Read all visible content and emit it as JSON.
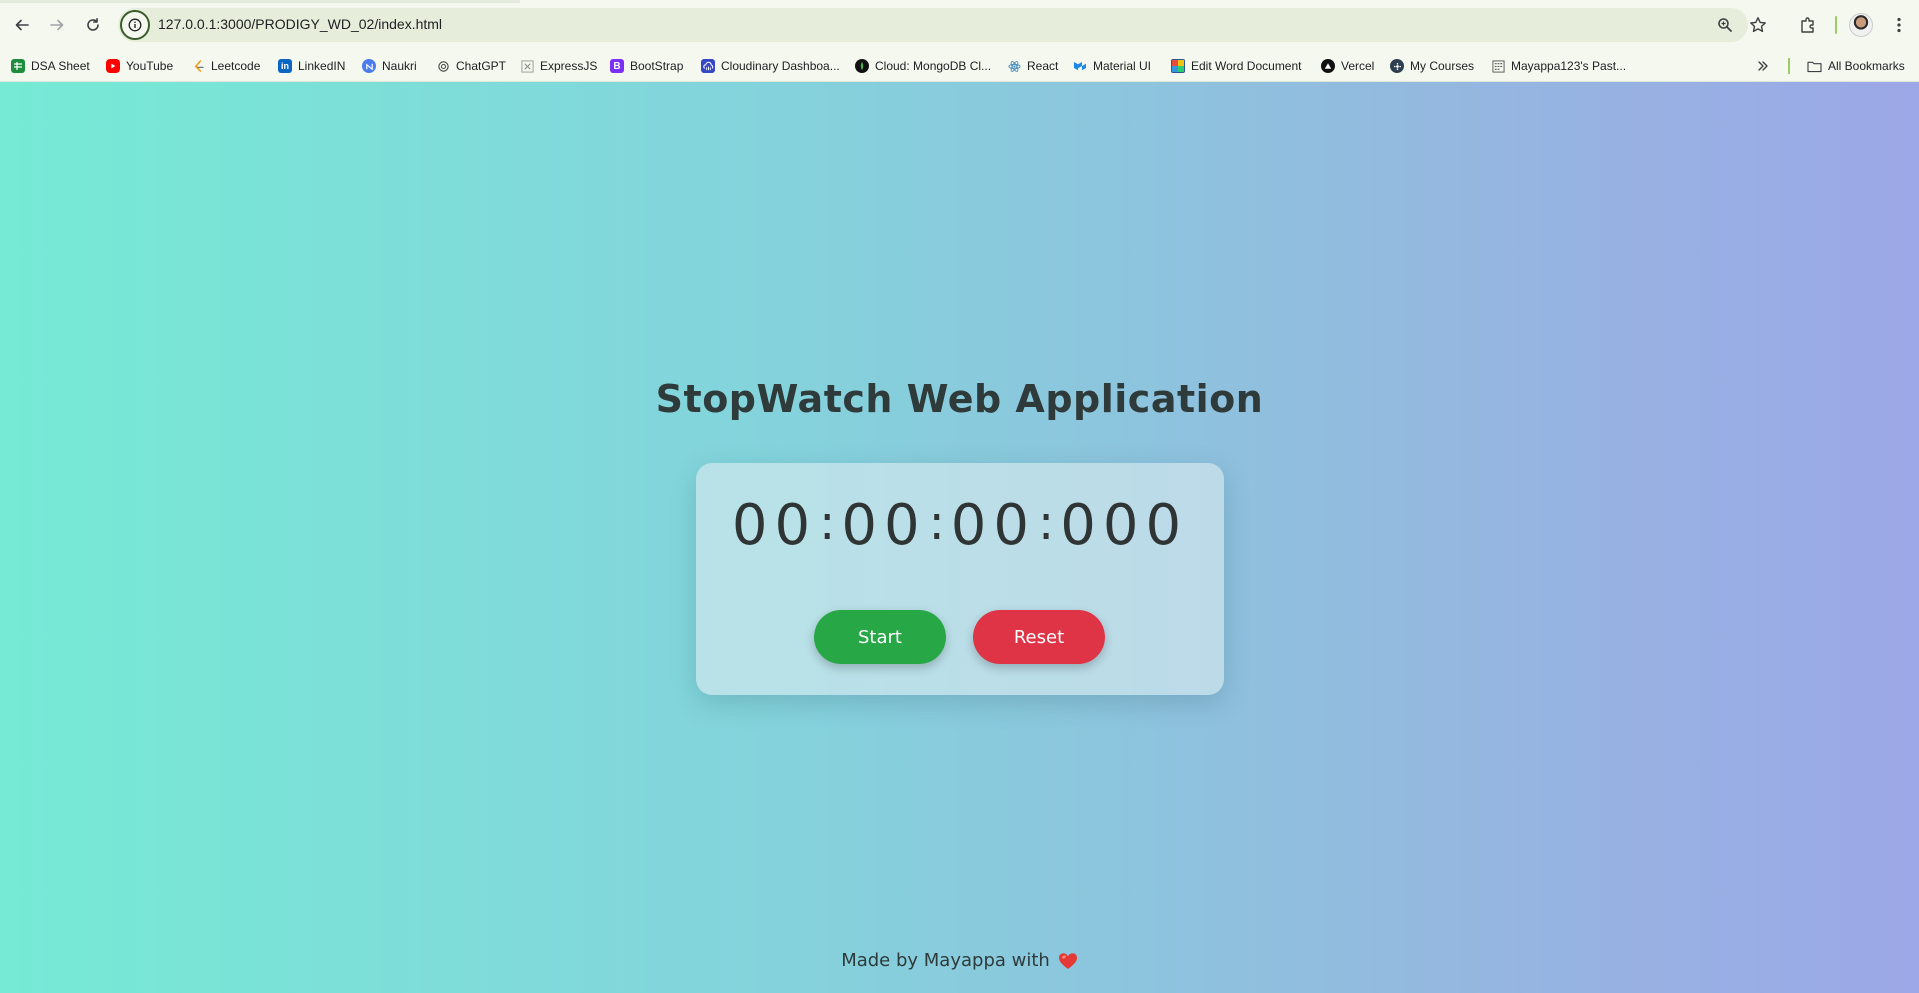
{
  "browser": {
    "url": "127.0.0.1:3000/PRODIGY_WD_02/index.html",
    "icons": [
      "back-icon",
      "forward-icon",
      "reload-icon",
      "site-info-icon",
      "zoom-icon",
      "star-icon",
      "extensions-icon",
      "profile-avatar",
      "menu-icon"
    ]
  },
  "bookmarks": {
    "items": [
      {
        "label": "DSA Sheet",
        "icon": "dsa-sheet-icon",
        "color": "#1e8e3e"
      },
      {
        "label": "YouTube",
        "icon": "youtube-icon",
        "color": "#ff0000"
      },
      {
        "label": "Leetcode",
        "icon": "leetcode-icon",
        "color": "#f0a020"
      },
      {
        "label": "LinkedIN",
        "icon": "linkedin-icon",
        "color": "#0a66c2"
      },
      {
        "label": "Naukri",
        "icon": "naukri-icon",
        "color": "#4a7cf0"
      },
      {
        "label": "ChatGPT",
        "icon": "chatgpt-icon",
        "color": "#444444"
      },
      {
        "label": "ExpressJS",
        "icon": "expressjs-icon",
        "color": "#888888"
      },
      {
        "label": "BootStrap",
        "icon": "bootstrap-icon",
        "color": "#7b2ff7"
      },
      {
        "label": "Cloudinary Dashboa...",
        "icon": "cloudinary-icon",
        "color": "#3448c5"
      },
      {
        "label": "Cloud: MongoDB Cl...",
        "icon": "mongodb-icon",
        "color": "#1b5e20"
      },
      {
        "label": "React",
        "icon": "react-icon",
        "color": "#4a90c0"
      },
      {
        "label": "Material UI",
        "icon": "material-ui-icon",
        "color": "#1e88e5"
      },
      {
        "label": "Edit Word Document",
        "icon": "word-doc-icon",
        "color": "#c0392b"
      },
      {
        "label": "Vercel",
        "icon": "vercel-icon",
        "color": "#111111"
      },
      {
        "label": "My Courses",
        "icon": "my-courses-icon",
        "color": "#2c3e50"
      },
      {
        "label": "Mayappa123's Past...",
        "icon": "pastebin-icon",
        "color": "#555555"
      }
    ],
    "overflow_icon": "double-chevron-icon",
    "all_bookmarks": "All Bookmarks"
  },
  "app": {
    "title": "StopWatch Web Application",
    "timer": {
      "hours": "00",
      "minutes": "00",
      "seconds": "00",
      "milliseconds": "000",
      "separator": ":"
    },
    "start_label": "Start",
    "reset_label": "Reset",
    "footer_text": "Made by Mayappa with",
    "footer_icon": "heart-icon",
    "colors": {
      "start": "#27a745",
      "reset": "#df3445",
      "heart": "#e53935"
    }
  }
}
